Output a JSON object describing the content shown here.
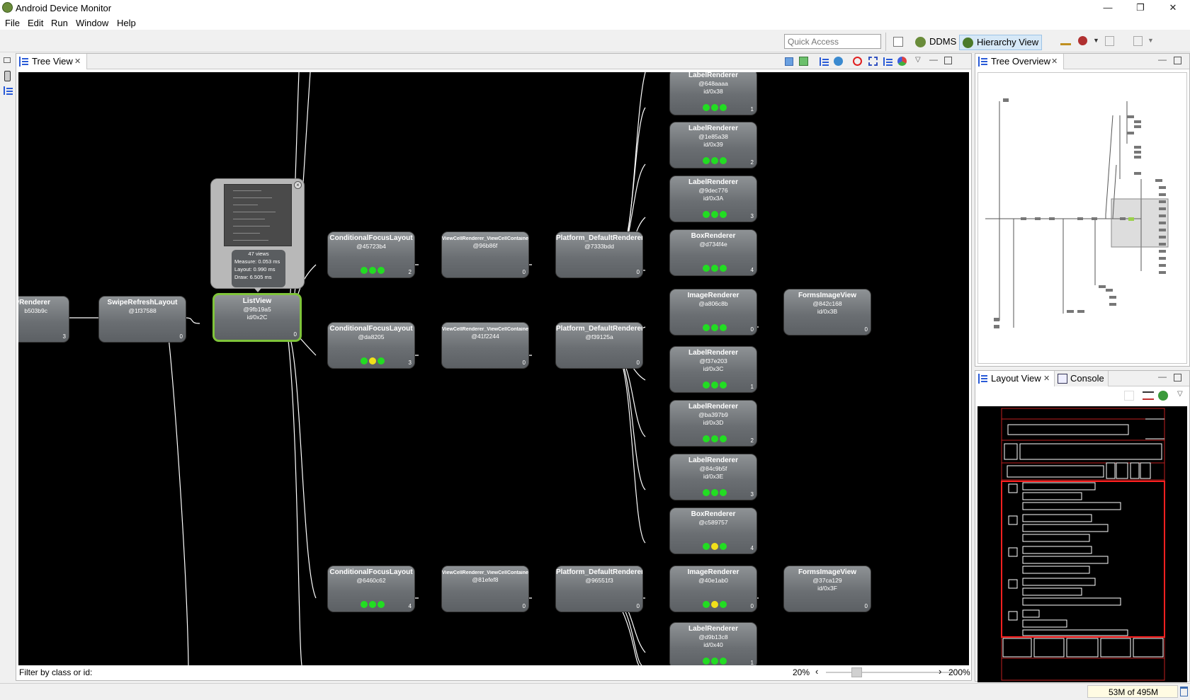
{
  "window": {
    "title": "Android Device Monitor",
    "controls": [
      "—",
      "❐",
      "✕"
    ]
  },
  "menu": [
    "File",
    "Edit",
    "Run",
    "Window",
    "Help"
  ],
  "toolbar": {
    "quick_access_placeholder": "Quick Access",
    "perspectives": [
      {
        "label": "DDMS",
        "active": false
      },
      {
        "label": "Hierarchy View",
        "active": true
      }
    ]
  },
  "tree_view": {
    "tab_label": "Tree View",
    "popup": {
      "views": "47 views",
      "measure": "Measure: 0.053 ms",
      "layout": "Layout: 0.990 ms",
      "draw": "Draw: 6.505 ms"
    },
    "filter_label": "Filter by class or id:",
    "zoom_min": "20%",
    "zoom_max": "200%",
    "nodes": [
      {
        "cls": "ewRenderer",
        "hash": "b503b9c",
        "id": "",
        "index": "3",
        "dots": []
      },
      {
        "cls": "SwipeRefreshLayout",
        "hash": "@1f37588",
        "id": "",
        "index": "0",
        "dots": []
      },
      {
        "cls": "ListView",
        "hash": "@9fb19a5",
        "id": "id/0x2C",
        "index": "0",
        "dots": [],
        "selected": true
      },
      {
        "cls": "ConditionalFocusLayout",
        "hash": "@45723b4",
        "id": "",
        "index": "2",
        "dots": [
          "g",
          "g",
          "g"
        ]
      },
      {
        "cls": "ConditionalFocusLayout",
        "hash": "@da8205",
        "id": "",
        "index": "3",
        "dots": [
          "g",
          "y",
          "g"
        ]
      },
      {
        "cls": "ConditionalFocusLayout",
        "hash": "@6460c62",
        "id": "",
        "index": "4",
        "dots": [
          "g",
          "g",
          "g"
        ]
      },
      {
        "cls": "ViewCellRenderer_ViewCellContainer",
        "hash": "@96b86f",
        "id": "",
        "index": "0",
        "dots": [],
        "small": true
      },
      {
        "cls": "ViewCellRenderer_ViewCellContainer",
        "hash": "@41f2244",
        "id": "",
        "index": "0",
        "dots": [],
        "small": true
      },
      {
        "cls": "ViewCellRenderer_ViewCellContainer",
        "hash": "@81efef8",
        "id": "",
        "index": "0",
        "dots": [],
        "small": true
      },
      {
        "cls": "Platform_DefaultRenderer",
        "hash": "@7333bdd",
        "id": "",
        "index": "0",
        "dots": []
      },
      {
        "cls": "Platform_DefaultRenderer",
        "hash": "@f39125a",
        "id": "",
        "index": "0",
        "dots": []
      },
      {
        "cls": "Platform_DefaultRenderer",
        "hash": "@96551f3",
        "id": "",
        "index": "0",
        "dots": []
      },
      {
        "cls": "LabelRenderer",
        "hash": "@648aaaa",
        "id": "id/0x38",
        "index": "1",
        "dots": [
          "g",
          "g",
          "g"
        ]
      },
      {
        "cls": "LabelRenderer",
        "hash": "@1e85a38",
        "id": "id/0x39",
        "index": "2",
        "dots": [
          "g",
          "g",
          "g"
        ]
      },
      {
        "cls": "LabelRenderer",
        "hash": "@9dec776",
        "id": "id/0x3A",
        "index": "3",
        "dots": [
          "g",
          "g",
          "g"
        ]
      },
      {
        "cls": "BoxRenderer",
        "hash": "@d734f4e",
        "id": "",
        "index": "4",
        "dots": [
          "g",
          "g",
          "g"
        ]
      },
      {
        "cls": "ImageRenderer",
        "hash": "@a806c8b",
        "id": "",
        "index": "0",
        "dots": [
          "g",
          "g",
          "g"
        ]
      },
      {
        "cls": "LabelRenderer",
        "hash": "@f37e203",
        "id": "id/0x3C",
        "index": "1",
        "dots": [
          "g",
          "g",
          "g"
        ]
      },
      {
        "cls": "LabelRenderer",
        "hash": "@ba397b9",
        "id": "id/0x3D",
        "index": "2",
        "dots": [
          "g",
          "g",
          "g"
        ]
      },
      {
        "cls": "LabelRenderer",
        "hash": "@84c9b5f",
        "id": "id/0x3E",
        "index": "3",
        "dots": [
          "g",
          "g",
          "g"
        ]
      },
      {
        "cls": "BoxRenderer",
        "hash": "@c589757",
        "id": "",
        "index": "4",
        "dots": [
          "g",
          "y",
          "g"
        ]
      },
      {
        "cls": "ImageRenderer",
        "hash": "@40e1ab0",
        "id": "",
        "index": "0",
        "dots": [
          "g",
          "y",
          "g"
        ]
      },
      {
        "cls": "LabelRenderer",
        "hash": "@d9b13c8",
        "id": "id/0x40",
        "index": "1",
        "dots": [
          "g",
          "g",
          "g"
        ]
      },
      {
        "cls": "FormsImageView",
        "hash": "@842c168",
        "id": "id/0x3B",
        "index": "0",
        "dots": []
      },
      {
        "cls": "FormsImageView",
        "hash": "@37ca129",
        "id": "id/0x3F",
        "index": "0",
        "dots": []
      }
    ]
  },
  "tree_overview": {
    "tab_label": "Tree Overview"
  },
  "layout_view": {
    "tab_label": "Layout View",
    "console_tab_label": "Console"
  },
  "status": {
    "memory": "53M of 495M"
  },
  "colors": {
    "green": "#22dd22",
    "yellow": "#f2e01a",
    "selected_border": "#7fc43a",
    "layout_red": "#ff2020"
  }
}
